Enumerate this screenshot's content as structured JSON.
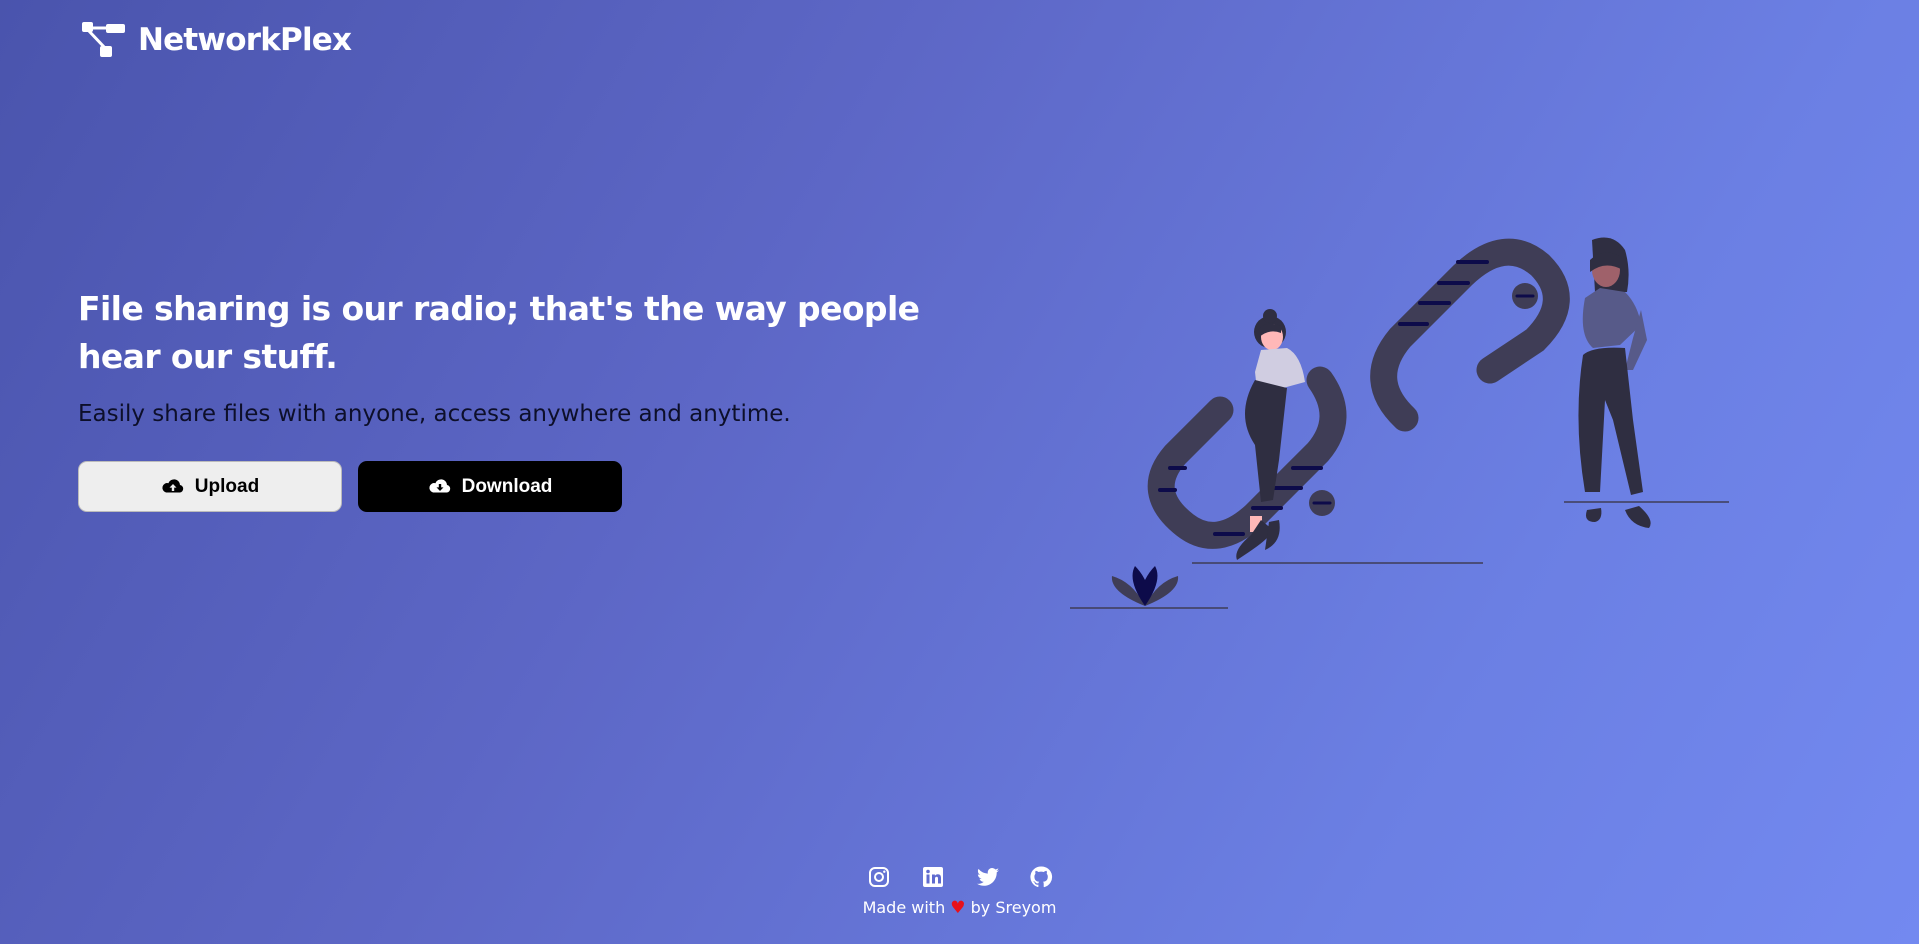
{
  "brand": {
    "name": "NetworkPlex",
    "logo_icon": "network-nodes-icon"
  },
  "hero": {
    "headline": "File sharing is our radio; that's the way people hear our stuff.",
    "subline": "Easily share files with anyone, access anywhere and anytime."
  },
  "buttons": {
    "upload": {
      "label": "Upload",
      "icon": "cloud-upload-icon"
    },
    "download": {
      "label": "Download",
      "icon": "cloud-download-icon"
    }
  },
  "footer": {
    "social": [
      "instagram-icon",
      "linkedin-icon",
      "twitter-icon",
      "github-icon"
    ],
    "made_with": "Made with",
    "heart": "♥",
    "by": "by Sreyom"
  },
  "colors": {
    "gradient_start": "#4a54ad",
    "gradient_end": "#7389f0",
    "subline_text": "#0d0f2a",
    "upload_bg": "#eeeeee",
    "download_bg": "#000000",
    "heart": "#e8101a"
  }
}
